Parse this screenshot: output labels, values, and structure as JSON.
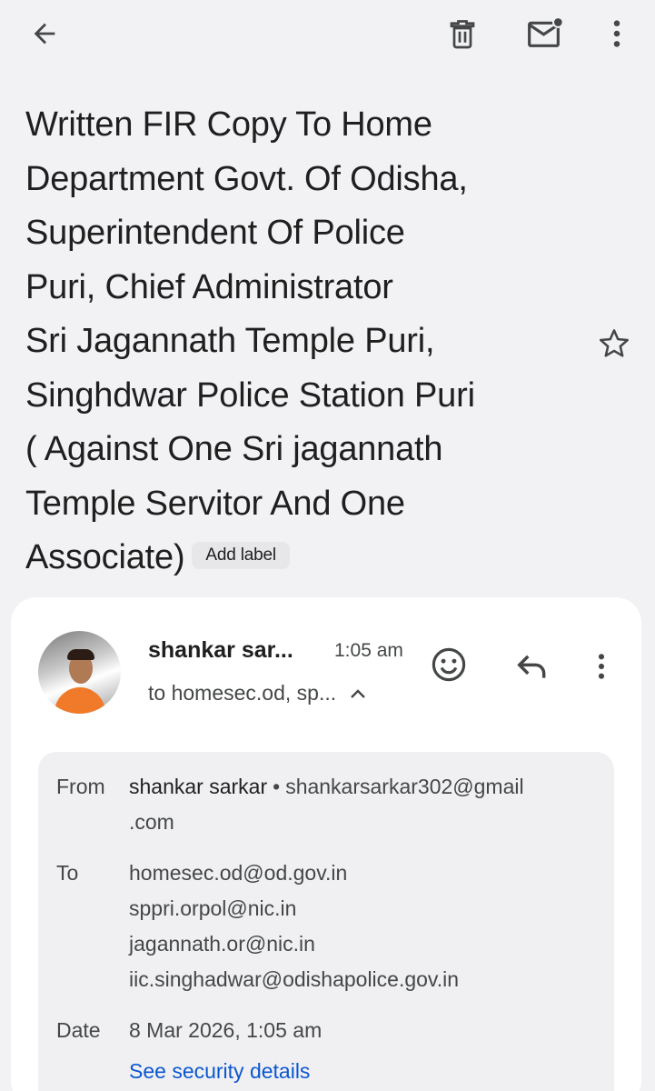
{
  "toolbar": {
    "back_icon": "arrow-back-icon",
    "delete_icon": "trash-icon",
    "mark_unread_icon": "mail-unread-icon",
    "more_icon": "more-vert-icon"
  },
  "subject": {
    "lines": [
      "Written FIR Copy To Home",
      "Department  Govt. Of Odisha,",
      "Superintendent Of Police",
      "Puri, Chief Administrator",
      "Sri Jagannath Temple Puri,",
      "Singhdwar Police Station Puri",
      "( Against One Sri jagannath",
      "Temple Servitor And One",
      "Associate)"
    ],
    "add_label": "Add label",
    "star_icon": "star-outline-icon"
  },
  "message": {
    "sender_short": "shankar sar...",
    "time": "1:05 am",
    "recipients_short": "to homesec.od, sp...",
    "details": {
      "from_label": "From",
      "from_name": "shankar sarkar",
      "from_sep": "•",
      "from_email_line1": "shankarsarkar302@gmail",
      "from_email_line2": ".com",
      "to_label": "To",
      "to": [
        "homesec.od@od.gov.in",
        "sppri.orpol@nic.in",
        "jagannath.or@nic.in",
        "iic.singhadwar@odishapolice.gov.in"
      ],
      "date_label": "Date",
      "date": "8 Mar 2026, 1:05 am",
      "security_link": "See security details"
    }
  },
  "colors": {
    "background": "#f2f2f4",
    "card": "#ffffff",
    "details_bg": "#f0f0f3",
    "link": "#0b57d0",
    "text": "#1f1f1f",
    "muted": "#444746"
  }
}
